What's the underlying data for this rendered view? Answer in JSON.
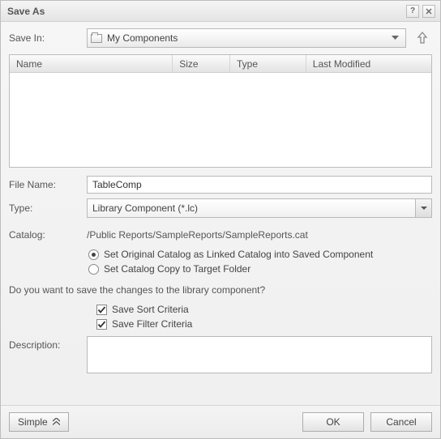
{
  "title": "Save As",
  "saveIn": {
    "label": "Save In:",
    "value": "My Components"
  },
  "columns": {
    "name": "Name",
    "size": "Size",
    "type": "Type",
    "modified": "Last Modified"
  },
  "fileName": {
    "label": "File Name:",
    "value": "TableComp"
  },
  "type": {
    "label": "Type:",
    "value": "Library Component (*.lc)"
  },
  "catalog": {
    "label": "Catalog:",
    "path": "/Public Reports/SampleReports/SampleReports.cat",
    "optionLinked": "Set Original Catalog as Linked Catalog into Saved Component",
    "optionCopy": "Set Catalog Copy to Target Folder"
  },
  "question": "Do you want to save the changes to the library component?",
  "checks": {
    "sort": "Save Sort Criteria",
    "filter": "Save Filter Criteria"
  },
  "description": {
    "label": "Description:",
    "value": ""
  },
  "buttons": {
    "simple": "Simple",
    "ok": "OK",
    "cancel": "Cancel"
  }
}
